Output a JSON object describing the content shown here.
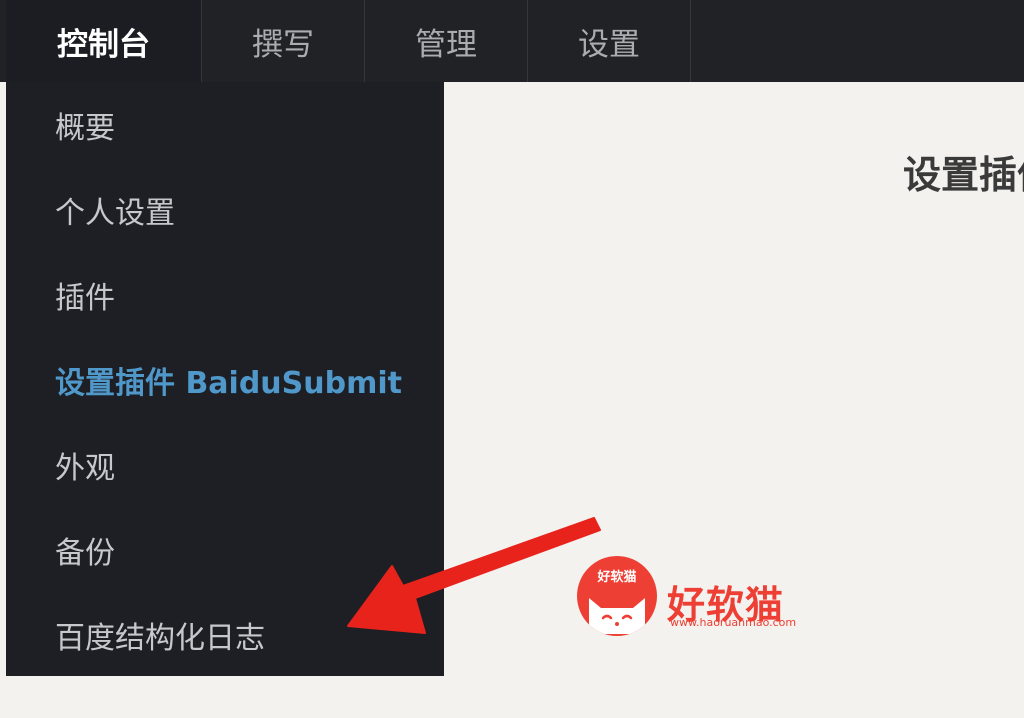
{
  "topbar": {
    "tabs": [
      {
        "label": "控制台",
        "active": true
      },
      {
        "label": "撰写",
        "active": false
      },
      {
        "label": "管理",
        "active": false
      },
      {
        "label": "设置",
        "active": false
      }
    ]
  },
  "dropdown": {
    "items": [
      {
        "label": "概要"
      },
      {
        "label": "个人设置"
      },
      {
        "label": "插件"
      },
      {
        "label": "设置插件 BaiduSubmit",
        "current": true
      },
      {
        "label": "外观"
      },
      {
        "label": "备份"
      },
      {
        "label": "百度结构化日志"
      }
    ]
  },
  "main": {
    "page_title": "设置插件 BaiduSubmit"
  },
  "watermark": {
    "badge": "好软猫",
    "title": "好软猫",
    "url": "www.haoruanmao.com"
  },
  "colors": {
    "nav_background": "#202226",
    "dropdown_background": "#1d1f25",
    "accent_link": "#4f98c9",
    "annotation_arrow": "#e8231c",
    "watermark_red": "#ee3f34"
  }
}
